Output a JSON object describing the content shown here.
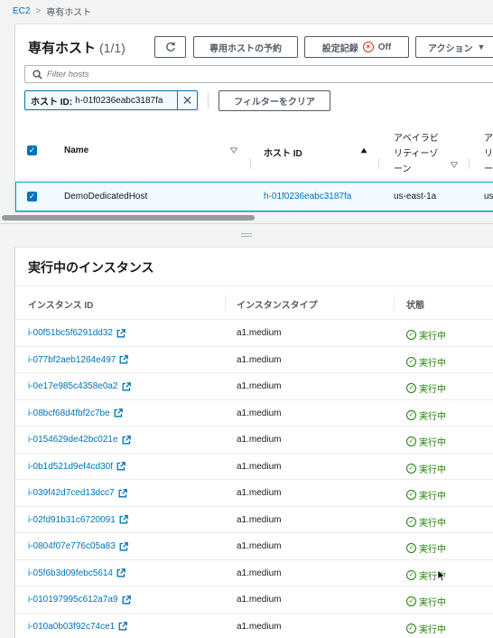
{
  "breadcrumb": {
    "root": "EC2",
    "separator": ">",
    "current": "専有ホスト"
  },
  "hosts_panel": {
    "title": "専有ホスト",
    "count": "(1/1)",
    "buttons": {
      "refresh_icon": "refresh-icon",
      "reserve": "専用ホストの予約",
      "settings_label": "設定記録",
      "settings_state": "Off",
      "actions": "アクション"
    },
    "search_placeholder": "Filter hosts",
    "filter_token": {
      "label": "ホスト ID:",
      "value": "h-01f0236eabc3187fa"
    },
    "clear_filters": "フィルターをクリア",
    "columns": {
      "name": "Name",
      "host_id": "ホスト ID",
      "az_line1": "アベイラビ",
      "az_line2": "リティーゾ",
      "az_line3": "ーン",
      "next_line1": "ア",
      "next_line2": "リ",
      "next_line3": "ー"
    },
    "rows": [
      {
        "name": "DemoDedicatedHost",
        "host_id": "h-01f0236eabc3187fa",
        "az": "us-east-1a",
        "next": "us"
      }
    ]
  },
  "instances_panel": {
    "title": "実行中のインスタンス",
    "columns": {
      "id": "インスタンス ID",
      "type": "インスタンスタイプ",
      "state": "状態"
    },
    "rows": [
      {
        "id": "i-00f51bc5f6291dd32",
        "type": "a1.medium",
        "state": "実行中"
      },
      {
        "id": "i-077bf2aeb1264e497",
        "type": "a1.medium",
        "state": "実行中"
      },
      {
        "id": "i-0e17e985c4358e0a2",
        "type": "a1.medium",
        "state": "実行中"
      },
      {
        "id": "i-08bcf68d4fbf2c7be",
        "type": "a1.medium",
        "state": "実行中"
      },
      {
        "id": "i-0154629de42bc021e",
        "type": "a1.medium",
        "state": "実行中"
      },
      {
        "id": "i-0b1d521d9ef4cd30f",
        "type": "a1.medium",
        "state": "実行中"
      },
      {
        "id": "i-039f42d7ced13dcc7",
        "type": "a1.medium",
        "state": "実行中"
      },
      {
        "id": "i-02fd91b31c6720091",
        "type": "a1.medium",
        "state": "実行中"
      },
      {
        "id": "i-0804f07e776c05a83",
        "type": "a1.medium",
        "state": "実行中"
      },
      {
        "id": "i-05f6b3d09febc5614",
        "type": "a1.medium",
        "state": "実行中"
      },
      {
        "id": "i-010197995c612a7a9",
        "type": "a1.medium",
        "state": "実行中"
      },
      {
        "id": "i-010a0b03f92c74ce1",
        "type": "a1.medium",
        "state": "実行中"
      }
    ]
  },
  "colors": {
    "link": "#0073bb",
    "success": "#1d8102",
    "danger": "#d13212",
    "selected_bg": "#f1faff"
  }
}
